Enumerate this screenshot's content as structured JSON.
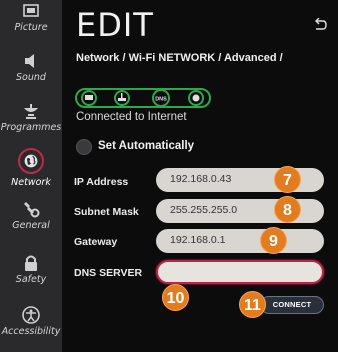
{
  "sidebar": {
    "items": [
      {
        "label": "Picture",
        "icon": "picture-icon"
      },
      {
        "label": "Sound",
        "icon": "speaker-icon"
      },
      {
        "label": "Programmes",
        "icon": "satellite-dish-icon"
      },
      {
        "label": "Network",
        "icon": "globe-icon"
      },
      {
        "label": "General",
        "icon": "wrench-gear-icon"
      },
      {
        "label": "Safety",
        "icon": "lock-icon"
      },
      {
        "label": "Accessibility",
        "icon": "accessibility-icon"
      }
    ],
    "active": "Network"
  },
  "header": {
    "title": "EDIT",
    "breadcrumb": "Network / Wi-Fi NETWORK / Advanced /"
  },
  "status": {
    "dns_label": "DNS",
    "text": "Connected to Internet",
    "color": "#2ea84a"
  },
  "set_automatically": {
    "label": "Set Automatically"
  },
  "fields": {
    "ip": {
      "label": "IP Address",
      "value": "192.168.0.43",
      "badge": "7"
    },
    "subnet": {
      "label": "Subnet Mask",
      "value": "255.255.255.0",
      "badge": "8"
    },
    "gateway": {
      "label": "Gateway",
      "value": "192.168.0.1",
      "badge": "9"
    },
    "dns": {
      "label": "DNS SERVER",
      "value": "",
      "badge": "10"
    }
  },
  "connect": {
    "label": "CONNECT",
    "badge": "11"
  },
  "colors": {
    "accent": "#c0284b",
    "badge": "#e37c1e",
    "status_green": "#2ea84a"
  }
}
